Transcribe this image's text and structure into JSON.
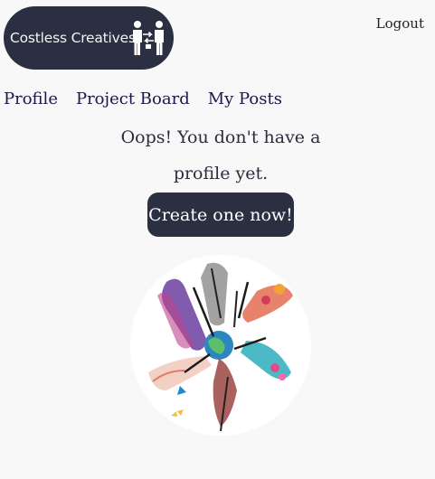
{
  "header": {
    "logo_text": "Costless Creatives",
    "logo_icon": "people-exchange-icon",
    "logout_label": "Logout"
  },
  "nav": {
    "items": [
      {
        "label": "Profile"
      },
      {
        "label": "Project Board"
      },
      {
        "label": "My Posts"
      }
    ]
  },
  "main": {
    "message_line1": "Oops! You don't have a",
    "message_line2": "profile yet.",
    "create_button_label": "Create one now!",
    "illustration": "artist-hands-circle-illustration"
  },
  "colors": {
    "brand_dark": "#2b2f42",
    "nav_text": "#1f1646",
    "background": "#f8f8f8"
  }
}
